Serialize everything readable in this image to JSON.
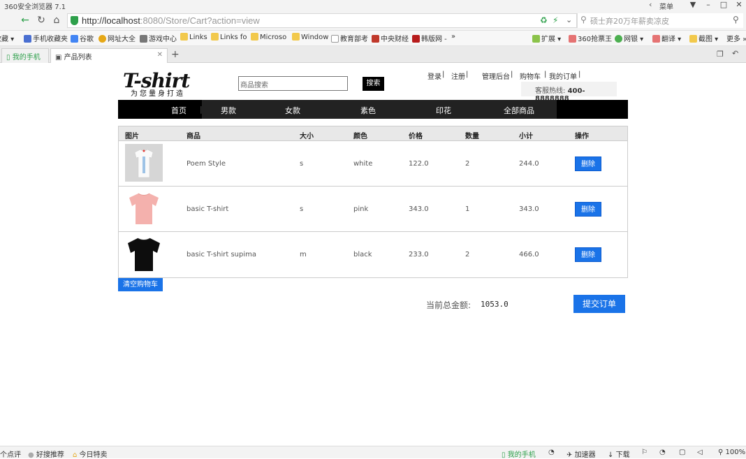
{
  "browser": {
    "title": "360安全浏览器 7.1",
    "menu_label": "菜单",
    "url_host": "http://localhost",
    "url_rest": ":8080/Store/Cart?action=view",
    "search_placeholder": "硕士弃20万年薪卖凉皮",
    "bookmarks": [
      "收藏",
      "手机收藏夹",
      "谷歌",
      "网址大全",
      "游戏中心",
      "Links",
      "Links fo",
      "Microso",
      "Window",
      "教育部考",
      "中央财经",
      "韩版网 -",
      "»"
    ],
    "bookmarks_right": [
      "扩展",
      "360抢票王",
      "网银",
      "翻译",
      "截图",
      "更多"
    ],
    "tabs": [
      {
        "label": "我的手机"
      },
      {
        "label": "产品列表"
      }
    ],
    "new_tab": "+",
    "status": {
      "left": [
        "个点评",
        "好搜推荐",
        "今日特卖"
      ],
      "right": [
        "我的手机",
        "加速器",
        "下载",
        "100%"
      ]
    }
  },
  "site": {
    "logo": "T-shirt",
    "tagline": "为您量身打造",
    "search_placeholder": "商品搜索",
    "search_button": "搜索",
    "top_links": [
      "登录",
      "注册",
      "管理后台",
      "购物车",
      "我的订单"
    ],
    "hotline_label": "客服热线:",
    "hotline_number": "400-8888888",
    "nav": [
      "首页",
      "男款",
      "女款",
      "素色",
      "印花",
      "全部商品"
    ]
  },
  "cart": {
    "headers": [
      "图片",
      "商品",
      "大小",
      "颜色",
      "价格",
      "数量",
      "小计",
      "操作"
    ],
    "rows": [
      {
        "name": "Poem Style",
        "size": "s",
        "color": "white",
        "price": "122.0",
        "qty": "2",
        "subtotal": "244.0",
        "action": "删除"
      },
      {
        "name": "basic T-shirt",
        "size": "s",
        "color": "pink",
        "price": "343.0",
        "qty": "1",
        "subtotal": "343.0",
        "action": "删除"
      },
      {
        "name": "basic T-shirt supima",
        "size": "m",
        "color": "black",
        "price": "233.0",
        "qty": "2",
        "subtotal": "466.0",
        "action": "删除"
      }
    ],
    "clear_button": "清空购物车",
    "total_label": "当前总金额:",
    "total_value": "1053.0",
    "submit_button": "提交订单"
  },
  "colors": {
    "accent": "#1a73e8",
    "nav_bg": "#000000"
  }
}
